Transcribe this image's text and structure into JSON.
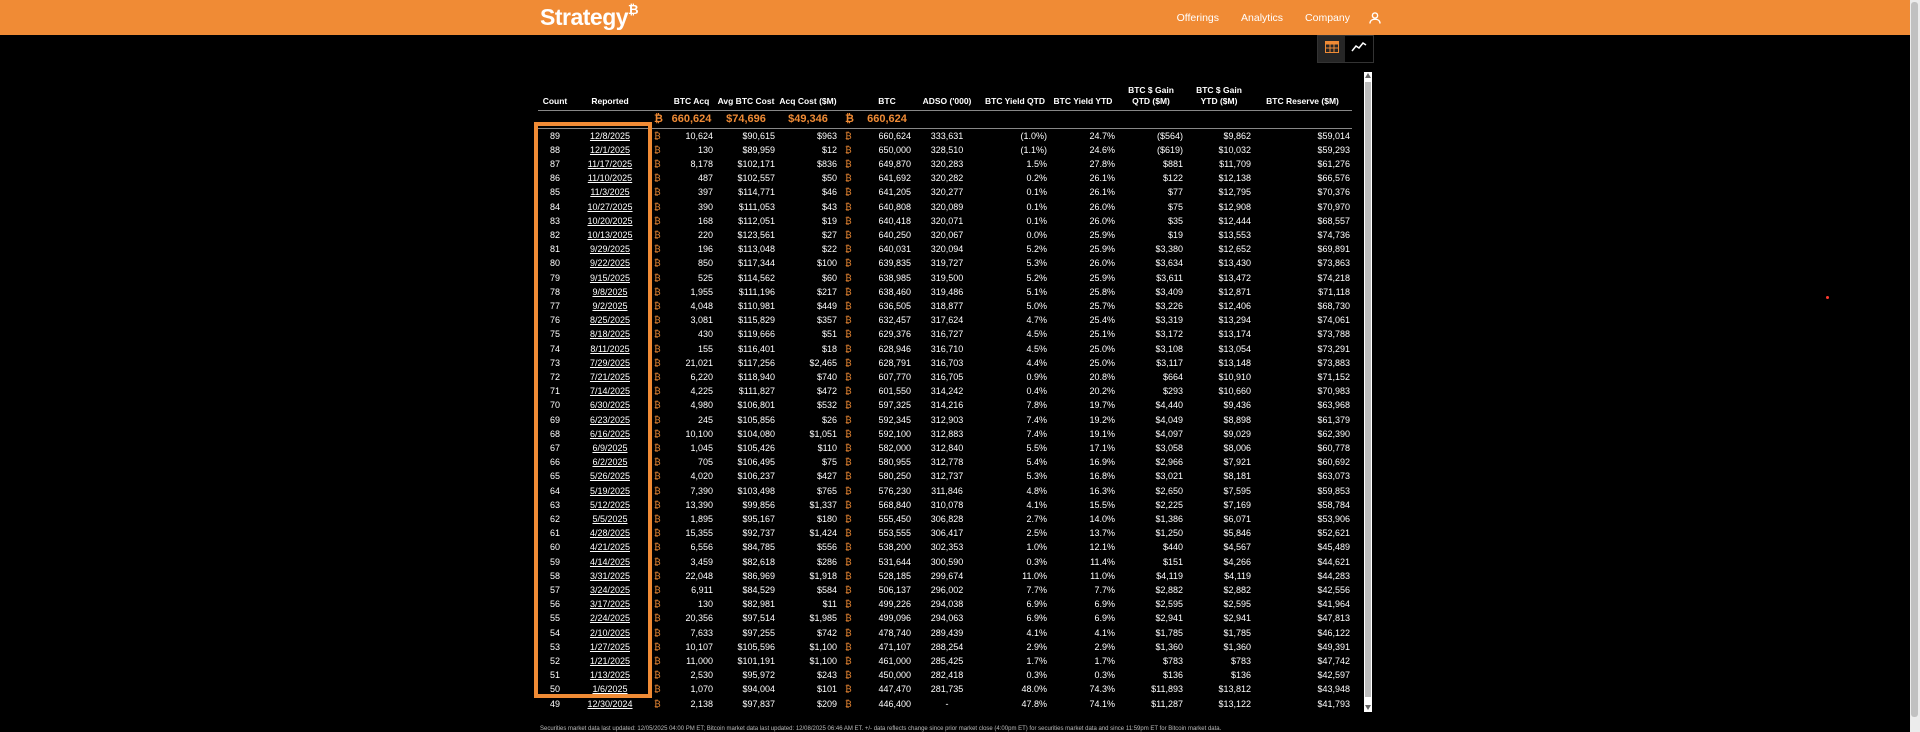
{
  "header": {
    "logo": "Strategy",
    "logo_mark": "₿",
    "nav": [
      "Offerings",
      "Analytics",
      "Company"
    ]
  },
  "view_toggle": {
    "icons": [
      "table-icon",
      "chart-line-icon"
    ],
    "active": 0
  },
  "table": {
    "headers": [
      "Count",
      "Reported",
      "",
      "BTC Acq",
      "Avg BTC Cost",
      "Acq Cost ($M)",
      "",
      "BTC",
      "ADSO ('000)",
      "BTC Yield QTD",
      "BTC Yield YTD",
      "BTC $ Gain QTD ($M)",
      "BTC $ Gain YTD ($M)",
      "BTC Reserve ($M)"
    ],
    "summary": [
      "",
      "",
      "₿",
      "660,624",
      "$74,696",
      "$49,346",
      "₿",
      "660,624",
      "",
      "",
      "",
      "",
      "",
      ""
    ],
    "rows": [
      [
        "89",
        "12/8/2025",
        "₿",
        "10,624",
        "$90,615",
        "$963",
        "₿",
        "660,624",
        "333,631",
        "(1.0%)",
        "24.7%",
        "($564)",
        "$9,862",
        "$59,014"
      ],
      [
        "88",
        "12/1/2025",
        "₿",
        "130",
        "$89,959",
        "$12",
        "₿",
        "650,000",
        "328,510",
        "(1.1%)",
        "24.6%",
        "($619)",
        "$10,032",
        "$59,293"
      ],
      [
        "87",
        "11/17/2025",
        "₿",
        "8,178",
        "$102,171",
        "$836",
        "₿",
        "649,870",
        "320,283",
        "1.5%",
        "27.8%",
        "$881",
        "$11,709",
        "$61,276"
      ],
      [
        "86",
        "11/10/2025",
        "₿",
        "487",
        "$102,557",
        "$50",
        "₿",
        "641,692",
        "320,282",
        "0.2%",
        "26.1%",
        "$122",
        "$12,138",
        "$66,576"
      ],
      [
        "85",
        "11/3/2025",
        "₿",
        "397",
        "$114,771",
        "$46",
        "₿",
        "641,205",
        "320,277",
        "0.1%",
        "26.1%",
        "$77",
        "$12,795",
        "$70,376"
      ],
      [
        "84",
        "10/27/2025",
        "₿",
        "390",
        "$111,053",
        "$43",
        "₿",
        "640,808",
        "320,089",
        "0.1%",
        "26.0%",
        "$75",
        "$12,908",
        "$70,970"
      ],
      [
        "83",
        "10/20/2025",
        "₿",
        "168",
        "$112,051",
        "$19",
        "₿",
        "640,418",
        "320,071",
        "0.1%",
        "26.0%",
        "$35",
        "$12,444",
        "$68,557"
      ],
      [
        "82",
        "10/13/2025",
        "₿",
        "220",
        "$123,561",
        "$27",
        "₿",
        "640,250",
        "320,067",
        "0.0%",
        "25.9%",
        "$19",
        "$13,553",
        "$74,736"
      ],
      [
        "81",
        "9/29/2025",
        "₿",
        "196",
        "$113,048",
        "$22",
        "₿",
        "640,031",
        "320,094",
        "5.2%",
        "25.9%",
        "$3,380",
        "$12,652",
        "$69,891"
      ],
      [
        "80",
        "9/22/2025",
        "₿",
        "850",
        "$117,344",
        "$100",
        "₿",
        "639,835",
        "319,727",
        "5.3%",
        "26.0%",
        "$3,634",
        "$13,430",
        "$73,863"
      ],
      [
        "79",
        "9/15/2025",
        "₿",
        "525",
        "$114,562",
        "$60",
        "₿",
        "638,985",
        "319,500",
        "5.2%",
        "25.9%",
        "$3,611",
        "$13,472",
        "$74,218"
      ],
      [
        "78",
        "9/8/2025",
        "₿",
        "1,955",
        "$111,196",
        "$217",
        "₿",
        "638,460",
        "319,486",
        "5.1%",
        "25.8%",
        "$3,409",
        "$12,871",
        "$71,118"
      ],
      [
        "77",
        "9/2/2025",
        "₿",
        "4,048",
        "$110,981",
        "$449",
        "₿",
        "636,505",
        "318,877",
        "5.0%",
        "25.7%",
        "$3,226",
        "$12,406",
        "$68,730"
      ],
      [
        "76",
        "8/25/2025",
        "₿",
        "3,081",
        "$115,829",
        "$357",
        "₿",
        "632,457",
        "317,624",
        "4.7%",
        "25.4%",
        "$3,319",
        "$13,294",
        "$74,061"
      ],
      [
        "75",
        "8/18/2025",
        "₿",
        "430",
        "$119,666",
        "$51",
        "₿",
        "629,376",
        "316,727",
        "4.5%",
        "25.1%",
        "$3,172",
        "$13,174",
        "$73,788"
      ],
      [
        "74",
        "8/11/2025",
        "₿",
        "155",
        "$116,401",
        "$18",
        "₿",
        "628,946",
        "316,710",
        "4.5%",
        "25.0%",
        "$3,108",
        "$13,054",
        "$73,291"
      ],
      [
        "73",
        "7/29/2025",
        "₿",
        "21,021",
        "$117,256",
        "$2,465",
        "₿",
        "628,791",
        "316,703",
        "4.4%",
        "25.0%",
        "$3,117",
        "$13,148",
        "$73,883"
      ],
      [
        "72",
        "7/21/2025",
        "₿",
        "6,220",
        "$118,940",
        "$740",
        "₿",
        "607,770",
        "316,705",
        "0.9%",
        "20.8%",
        "$664",
        "$10,910",
        "$71,152"
      ],
      [
        "71",
        "7/14/2025",
        "₿",
        "4,225",
        "$111,827",
        "$472",
        "₿",
        "601,550",
        "314,242",
        "0.4%",
        "20.2%",
        "$293",
        "$10,660",
        "$70,983"
      ],
      [
        "70",
        "6/30/2025",
        "₿",
        "4,980",
        "$106,801",
        "$532",
        "₿",
        "597,325",
        "314,216",
        "7.8%",
        "19.7%",
        "$4,440",
        "$9,436",
        "$63,968"
      ],
      [
        "69",
        "6/23/2025",
        "₿",
        "245",
        "$105,856",
        "$26",
        "₿",
        "592,345",
        "312,903",
        "7.4%",
        "19.2%",
        "$4,049",
        "$8,898",
        "$61,379"
      ],
      [
        "68",
        "6/16/2025",
        "₿",
        "10,100",
        "$104,080",
        "$1,051",
        "₿",
        "592,100",
        "312,883",
        "7.4%",
        "19.1%",
        "$4,097",
        "$9,029",
        "$62,390"
      ],
      [
        "67",
        "6/9/2025",
        "₿",
        "1,045",
        "$105,426",
        "$110",
        "₿",
        "582,000",
        "312,840",
        "5.5%",
        "17.1%",
        "$3,058",
        "$8,006",
        "$60,778"
      ],
      [
        "66",
        "6/2/2025",
        "₿",
        "705",
        "$106,495",
        "$75",
        "₿",
        "580,955",
        "312,778",
        "5.4%",
        "16.9%",
        "$2,966",
        "$7,921",
        "$60,692"
      ],
      [
        "65",
        "5/26/2025",
        "₿",
        "4,020",
        "$106,237",
        "$427",
        "₿",
        "580,250",
        "312,737",
        "5.3%",
        "16.8%",
        "$3,021",
        "$8,181",
        "$63,073"
      ],
      [
        "64",
        "5/19/2025",
        "₿",
        "7,390",
        "$103,498",
        "$765",
        "₿",
        "576,230",
        "311,846",
        "4.8%",
        "16.3%",
        "$2,650",
        "$7,595",
        "$59,853"
      ],
      [
        "63",
        "5/12/2025",
        "₿",
        "13,390",
        "$99,856",
        "$1,337",
        "₿",
        "568,840",
        "310,078",
        "4.1%",
        "15.5%",
        "$2,225",
        "$7,169",
        "$58,784"
      ],
      [
        "62",
        "5/5/2025",
        "₿",
        "1,895",
        "$95,167",
        "$180",
        "₿",
        "555,450",
        "306,828",
        "2.7%",
        "14.0%",
        "$1,386",
        "$6,071",
        "$53,906"
      ],
      [
        "61",
        "4/28/2025",
        "₿",
        "15,355",
        "$92,737",
        "$1,424",
        "₿",
        "553,555",
        "306,417",
        "2.5%",
        "13.7%",
        "$1,250",
        "$5,846",
        "$52,621"
      ],
      [
        "60",
        "4/21/2025",
        "₿",
        "6,556",
        "$84,785",
        "$556",
        "₿",
        "538,200",
        "302,353",
        "1.0%",
        "12.1%",
        "$440",
        "$4,567",
        "$45,489"
      ],
      [
        "59",
        "4/14/2025",
        "₿",
        "3,459",
        "$82,618",
        "$286",
        "₿",
        "531,644",
        "300,590",
        "0.3%",
        "11.4%",
        "$151",
        "$4,266",
        "$44,621"
      ],
      [
        "58",
        "3/31/2025",
        "₿",
        "22,048",
        "$86,969",
        "$1,918",
        "₿",
        "528,185",
        "299,674",
        "11.0%",
        "11.0%",
        "$4,119",
        "$4,119",
        "$44,283"
      ],
      [
        "57",
        "3/24/2025",
        "₿",
        "6,911",
        "$84,529",
        "$584",
        "₿",
        "506,137",
        "296,002",
        "7.7%",
        "7.7%",
        "$2,882",
        "$2,882",
        "$42,556"
      ],
      [
        "56",
        "3/17/2025",
        "₿",
        "130",
        "$82,981",
        "$11",
        "₿",
        "499,226",
        "294,038",
        "6.9%",
        "6.9%",
        "$2,595",
        "$2,595",
        "$41,964"
      ],
      [
        "55",
        "2/24/2025",
        "₿",
        "20,356",
        "$97,514",
        "$1,985",
        "₿",
        "499,096",
        "294,063",
        "6.9%",
        "6.9%",
        "$2,941",
        "$2,941",
        "$47,813"
      ],
      [
        "54",
        "2/10/2025",
        "₿",
        "7,633",
        "$97,255",
        "$742",
        "₿",
        "478,740",
        "289,439",
        "4.1%",
        "4.1%",
        "$1,785",
        "$1,785",
        "$46,122"
      ],
      [
        "53",
        "1/27/2025",
        "₿",
        "10,107",
        "$105,596",
        "$1,100",
        "₿",
        "471,107",
        "288,254",
        "2.9%",
        "2.9%",
        "$1,360",
        "$1,360",
        "$49,391"
      ],
      [
        "52",
        "1/21/2025",
        "₿",
        "11,000",
        "$101,191",
        "$1,100",
        "₿",
        "461,000",
        "285,425",
        "1.7%",
        "1.7%",
        "$783",
        "$783",
        "$47,742"
      ],
      [
        "51",
        "1/13/2025",
        "₿",
        "2,530",
        "$95,972",
        "$243",
        "₿",
        "450,000",
        "282,418",
        "0.3%",
        "0.3%",
        "$136",
        "$136",
        "$42,597"
      ],
      [
        "50",
        "1/6/2025",
        "₿",
        "1,070",
        "$94,004",
        "$101",
        "₿",
        "447,470",
        "281,735",
        "48.0%",
        "74.3%",
        "$11,893",
        "$13,812",
        "$43,948"
      ],
      [
        "49",
        "12/30/2024",
        "₿",
        "2,138",
        "$97,837",
        "$209",
        "₿",
        "446,400",
        "-",
        "47.8%",
        "74.1%",
        "$11,287",
        "$13,122",
        "$41,793"
      ]
    ]
  },
  "footer": "Securities market data last updated: 12/05/2025 04:00 PM ET; Bitcoin market data last updated: 12/08/2025 06:46 AM ET. +/- data reflects change since prior market close (4:00pm ET) for securities market data and since 11:59pm ET for Bitcoin market data."
}
